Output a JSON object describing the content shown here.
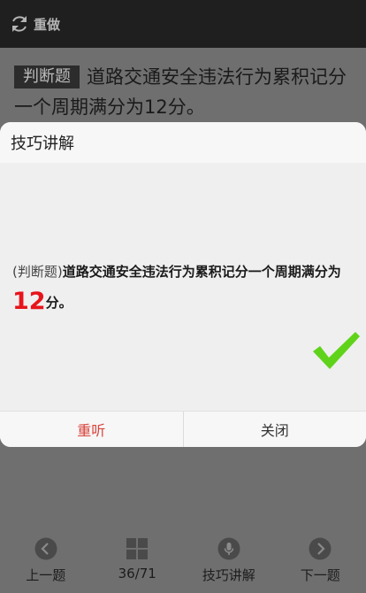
{
  "topbar": {
    "redo_label": "重做"
  },
  "question": {
    "type_label": "判断题",
    "text": "道路交通安全违法行为累积记分一个周期满分为12分。"
  },
  "modal": {
    "title": "技巧讲解",
    "explain": {
      "tag": "(判断题)",
      "text_part1": "道路交通安全违法行为累积记分一个周期满分为",
      "highlight": "12",
      "text_part2": "分。"
    },
    "relisten_label": "重听",
    "close_label": "关闭"
  },
  "bottombar": {
    "prev_label": "上一题",
    "progress_label": "36/71",
    "tips_label": "技巧讲解",
    "next_label": "下一题"
  },
  "colors": {
    "accent_red": "#e8141b",
    "check_green": "#5fd31a",
    "relisten_red": "#d8433a"
  }
}
